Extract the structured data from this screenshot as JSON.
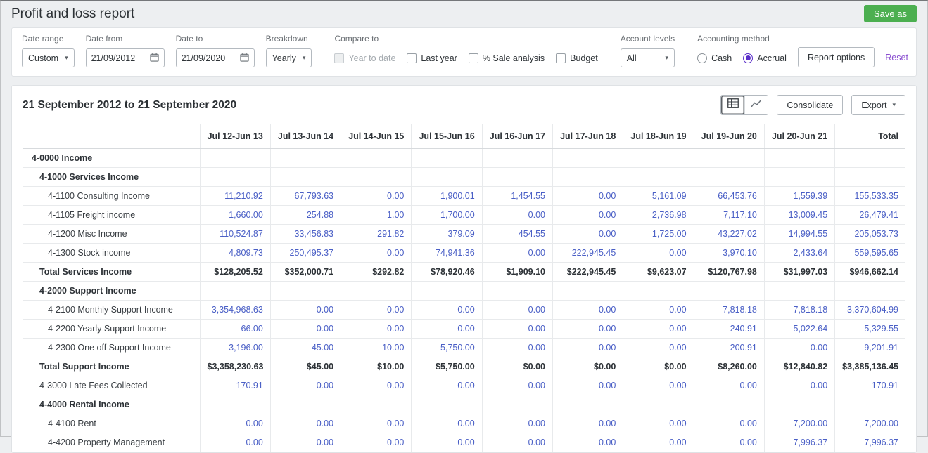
{
  "colors": {
    "green_button": "#4caf50",
    "accent_purple": "#5b2fc9",
    "link_purple": "#8a4fd0",
    "value_blue": "#4a5fc6"
  },
  "icons": {
    "chevron_down": "▾"
  },
  "header": {
    "title": "Profit and loss report",
    "save_as_label": "Save as"
  },
  "filters": {
    "date_range": {
      "label": "Date range",
      "value": "Custom"
    },
    "date_from": {
      "label": "Date from",
      "value": "21/09/2012"
    },
    "date_to": {
      "label": "Date to",
      "value": "21/09/2020"
    },
    "breakdown": {
      "label": "Breakdown",
      "value": "Yearly"
    },
    "compare_to": {
      "label": "Compare to",
      "options": [
        {
          "label": "Year to date",
          "checked": false,
          "disabled": true
        },
        {
          "label": "Last year",
          "checked": false,
          "disabled": false
        },
        {
          "label": "% Sale analysis",
          "checked": false,
          "disabled": false
        },
        {
          "label": "Budget",
          "checked": false,
          "disabled": false
        }
      ]
    },
    "account_levels": {
      "label": "Account levels",
      "value": "All"
    },
    "accounting_method": {
      "label": "Accounting method",
      "options": [
        {
          "label": "Cash",
          "selected": false
        },
        {
          "label": "Accrual",
          "selected": true
        }
      ]
    },
    "report_options_label": "Report options",
    "reset_label": "Reset"
  },
  "report": {
    "heading": "21 September 2012 to 21 September 2020",
    "consolidate_label": "Consolidate",
    "export_label": "Export"
  },
  "table": {
    "columns": [
      "Jul 12-Jun 13",
      "Jul 13-Jun 14",
      "Jul 14-Jun 15",
      "Jul 15-Jun 16",
      "Jul 16-Jun 17",
      "Jul 17-Jun 18",
      "Jul 18-Jun 19",
      "Jul 19-Jun 20",
      "Jul 20-Jun 21",
      "Total"
    ],
    "rows": [
      {
        "label": "4-0000 Income",
        "type": "section",
        "indent": 1,
        "values": [
          "",
          "",
          "",
          "",
          "",
          "",
          "",
          "",
          "",
          ""
        ]
      },
      {
        "label": "4-1000 Services Income",
        "type": "section",
        "indent": 2,
        "values": [
          "",
          "",
          "",
          "",
          "",
          "",
          "",
          "",
          "",
          ""
        ]
      },
      {
        "label": "4-1100 Consulting Income",
        "type": "detail",
        "indent": 3,
        "values": [
          "11,210.92",
          "67,793.63",
          "0.00",
          "1,900.01",
          "1,454.55",
          "0.00",
          "5,161.09",
          "66,453.76",
          "1,559.39",
          "155,533.35"
        ]
      },
      {
        "label": "4-1105 Freight income",
        "type": "detail",
        "indent": 3,
        "values": [
          "1,660.00",
          "254.88",
          "1.00",
          "1,700.00",
          "0.00",
          "0.00",
          "2,736.98",
          "7,117.10",
          "13,009.45",
          "26,479.41"
        ]
      },
      {
        "label": "4-1200 Misc Income",
        "type": "detail",
        "indent": 3,
        "values": [
          "110,524.87",
          "33,456.83",
          "291.82",
          "379.09",
          "454.55",
          "0.00",
          "1,725.00",
          "43,227.02",
          "14,994.55",
          "205,053.73"
        ]
      },
      {
        "label": "4-1300 Stock income",
        "type": "detail",
        "indent": 3,
        "values": [
          "4,809.73",
          "250,495.37",
          "0.00",
          "74,941.36",
          "0.00",
          "222,945.45",
          "0.00",
          "3,970.10",
          "2,433.64",
          "559,595.65"
        ]
      },
      {
        "label": "Total Services Income",
        "type": "total",
        "indent": 2,
        "values": [
          "$128,205.52",
          "$352,000.71",
          "$292.82",
          "$78,920.46",
          "$1,909.10",
          "$222,945.45",
          "$9,623.07",
          "$120,767.98",
          "$31,997.03",
          "$946,662.14"
        ]
      },
      {
        "label": "4-2000 Support Income",
        "type": "section",
        "indent": 2,
        "values": [
          "",
          "",
          "",
          "",
          "",
          "",
          "",
          "",
          "",
          ""
        ]
      },
      {
        "label": "4-2100 Monthly Support Income",
        "type": "detail",
        "indent": 3,
        "values": [
          "3,354,968.63",
          "0.00",
          "0.00",
          "0.00",
          "0.00",
          "0.00",
          "0.00",
          "7,818.18",
          "7,818.18",
          "3,370,604.99"
        ]
      },
      {
        "label": "4-2200 Yearly Support Income",
        "type": "detail",
        "indent": 3,
        "values": [
          "66.00",
          "0.00",
          "0.00",
          "0.00",
          "0.00",
          "0.00",
          "0.00",
          "240.91",
          "5,022.64",
          "5,329.55"
        ]
      },
      {
        "label": "4-2300 One off Support Income",
        "type": "detail",
        "indent": 3,
        "values": [
          "3,196.00",
          "45.00",
          "10.00",
          "5,750.00",
          "0.00",
          "0.00",
          "0.00",
          "200.91",
          "0.00",
          "9,201.91"
        ]
      },
      {
        "label": "Total Support Income",
        "type": "total",
        "indent": 2,
        "values": [
          "$3,358,230.63",
          "$45.00",
          "$10.00",
          "$5,750.00",
          "$0.00",
          "$0.00",
          "$0.00",
          "$8,260.00",
          "$12,840.82",
          "$3,385,136.45"
        ]
      },
      {
        "label": "4-3000 Late Fees Collected",
        "type": "detail",
        "indent": 2,
        "values": [
          "170.91",
          "0.00",
          "0.00",
          "0.00",
          "0.00",
          "0.00",
          "0.00",
          "0.00",
          "0.00",
          "170.91"
        ]
      },
      {
        "label": "4-4000 Rental Income",
        "type": "section",
        "indent": 2,
        "values": [
          "",
          "",
          "",
          "",
          "",
          "",
          "",
          "",
          "",
          ""
        ]
      },
      {
        "label": "4-4100 Rent",
        "type": "detail",
        "indent": 3,
        "values": [
          "0.00",
          "0.00",
          "0.00",
          "0.00",
          "0.00",
          "0.00",
          "0.00",
          "0.00",
          "7,200.00",
          "7,200.00"
        ]
      },
      {
        "label": "4-4200 Property Management",
        "type": "detail",
        "indent": 3,
        "values": [
          "0.00",
          "0.00",
          "0.00",
          "0.00",
          "0.00",
          "0.00",
          "0.00",
          "0.00",
          "7,996.37",
          "7,996.37"
        ]
      }
    ]
  }
}
